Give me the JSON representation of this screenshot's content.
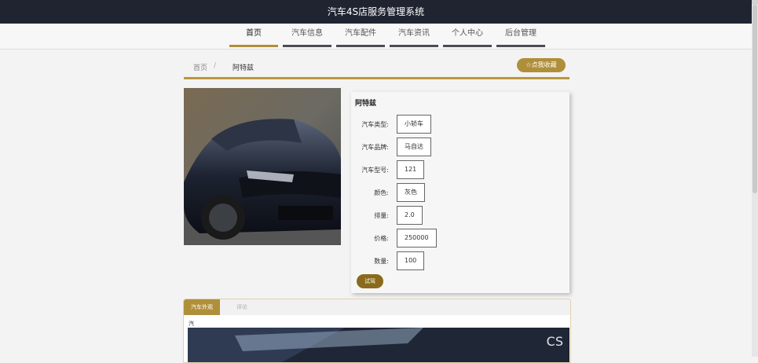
{
  "app": {
    "title": "汽车4S店服务管理系统"
  },
  "nav": {
    "items": [
      {
        "label": "首页",
        "active": true
      },
      {
        "label": "汽车信息",
        "active": false
      },
      {
        "label": "汽车配件",
        "active": false
      },
      {
        "label": "汽车资讯",
        "active": false
      },
      {
        "label": "个人中心",
        "active": false
      },
      {
        "label": "后台管理",
        "active": false
      }
    ]
  },
  "breadcrumb": {
    "home": "首页",
    "separator": "/",
    "current": "阿特兹"
  },
  "favorite": {
    "icon": "star-outline-icon",
    "label": "☆点我收藏"
  },
  "car": {
    "name": "阿特兹",
    "fields": [
      {
        "label": "汽车类型:",
        "value": "小轿车"
      },
      {
        "label": "汽车品牌:",
        "value": "马自达"
      },
      {
        "label": "汽车型号:",
        "value": "121"
      },
      {
        "label": "颜色:",
        "value": "灰色"
      },
      {
        "label": "排量:",
        "value": "2.0"
      },
      {
        "label": "价格:",
        "value": "250000"
      },
      {
        "label": "数量:",
        "value": "100"
      }
    ],
    "test_drive_label": "试驾"
  },
  "tabs": {
    "items": [
      {
        "label": "汽车外观",
        "active": true
      },
      {
        "label": "评论",
        "active": false
      }
    ],
    "content_label": "汽",
    "image_text": "CS"
  },
  "colors": {
    "accent": "#b08f3a",
    "topbar": "#1f2430",
    "nav_bar": "#4a4d54"
  }
}
